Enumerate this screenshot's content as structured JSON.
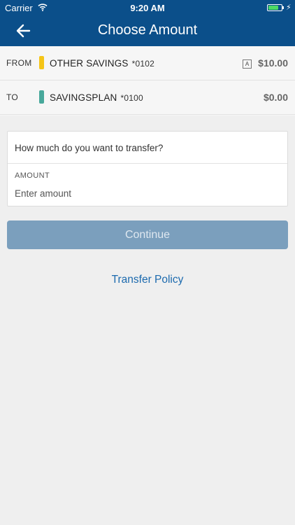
{
  "status_bar": {
    "carrier": "Carrier",
    "time": "9:20 AM",
    "battery_level": 0.75,
    "battery_color": "#4cd964",
    "wifi_icon": "wifi-icon",
    "charging_icon": "bolt-icon"
  },
  "header": {
    "title": "Choose Amount",
    "back_icon": "back-arrow-icon",
    "background_color": "#0b4f8a"
  },
  "accounts": {
    "from": {
      "label": "FROM",
      "name": "OTHER SAVINGS",
      "number": "*0102",
      "amount": "$10.00",
      "badge": "A",
      "color": "#f5c518"
    },
    "to": {
      "label": "TO",
      "name": "SAVINGSPLAN",
      "number": "*0100",
      "amount": "$0.00",
      "color": "#48a89b"
    }
  },
  "form": {
    "question": "How much do you want to transfer?",
    "amount_label": "AMOUNT",
    "amount_placeholder": "Enter amount",
    "amount_value": ""
  },
  "actions": {
    "continue_label": "Continue",
    "continue_color": "#7b9fbd",
    "policy_link": "Transfer Policy",
    "link_color": "#1c6aae"
  }
}
